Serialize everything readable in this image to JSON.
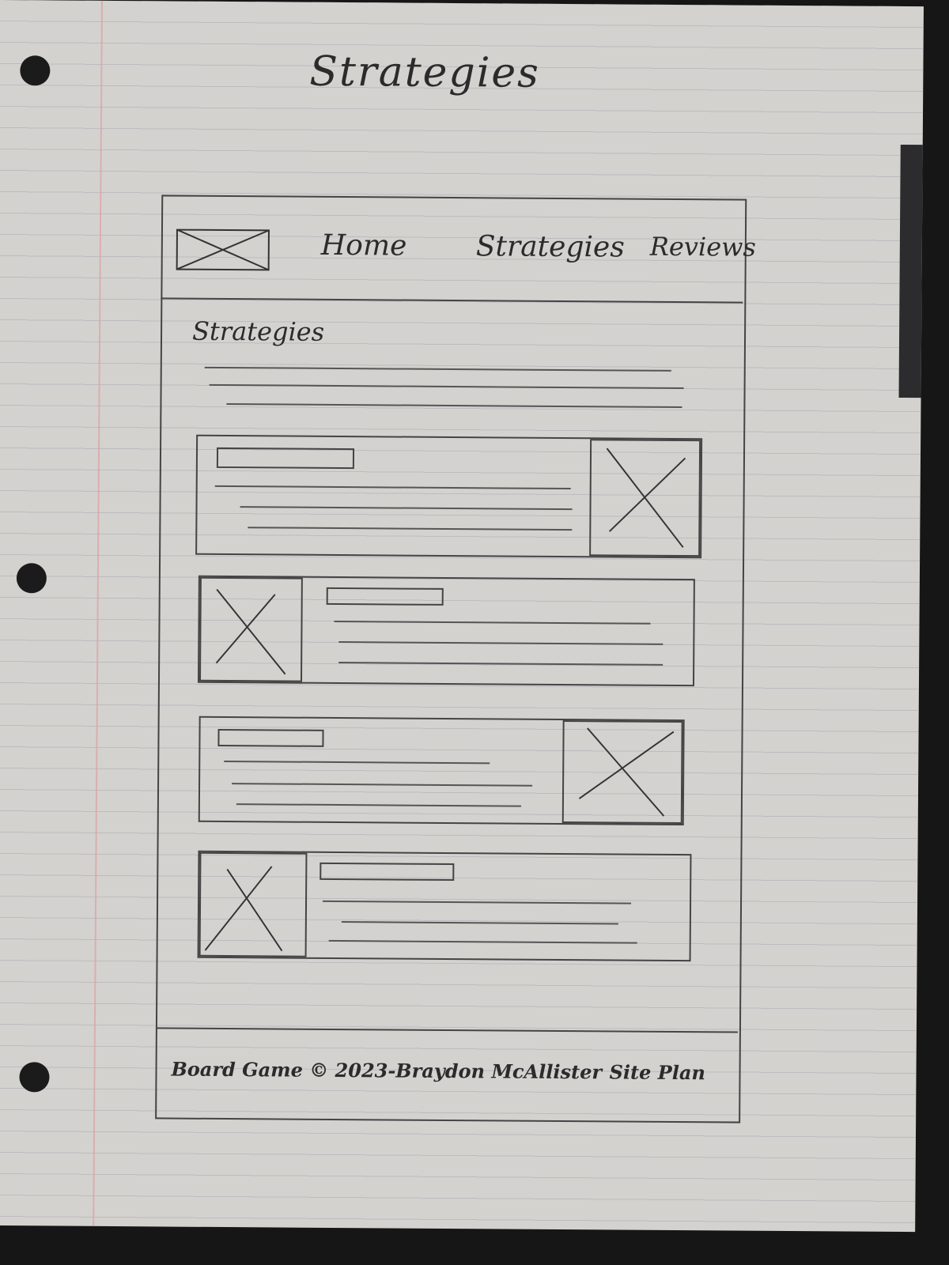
{
  "page_heading": "Strategies",
  "nav": {
    "logo": "logo-placeholder-icon",
    "links": [
      "Home",
      "Strategies",
      "Reviews"
    ]
  },
  "section_title": "Strategies",
  "cards": [
    {
      "image_side": "right"
    },
    {
      "image_side": "left"
    },
    {
      "image_side": "right"
    },
    {
      "image_side": "left"
    }
  ],
  "footer": {
    "copyright": "Board Game © 2023-Braydon McAllister",
    "site_plan": "Site Plan"
  },
  "colors": {
    "paper": "#d4d2cf",
    "ink": "#2b2b2b",
    "margin_line": "#d9a6a6"
  }
}
